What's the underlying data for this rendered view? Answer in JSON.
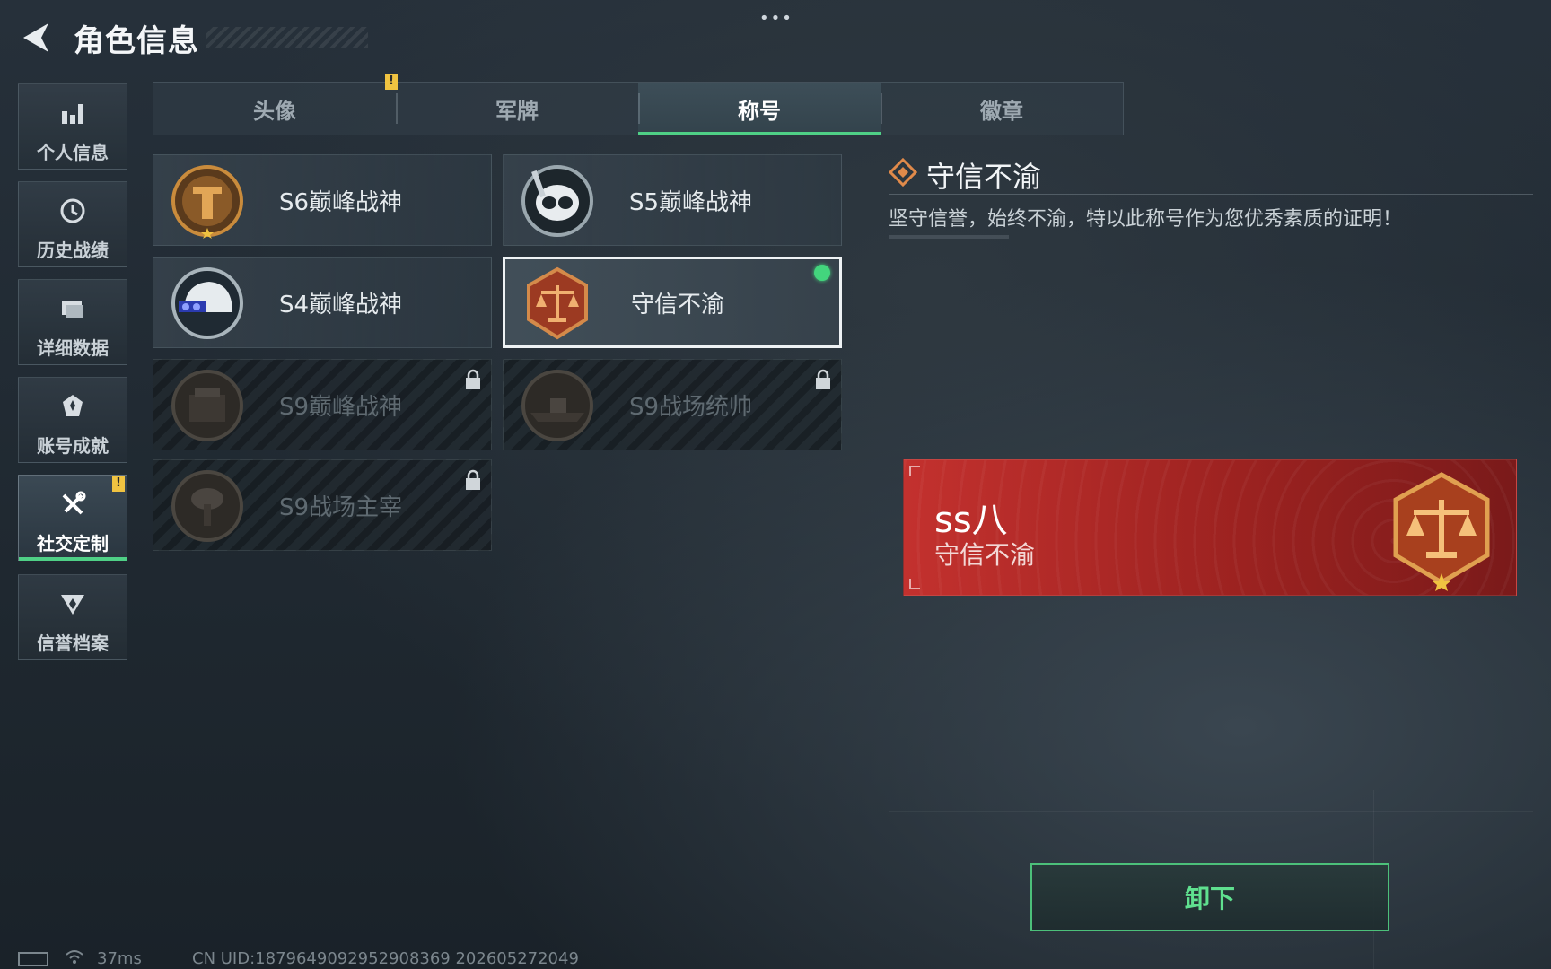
{
  "header": {
    "title": "角色信息",
    "more": "•••"
  },
  "sidebar": {
    "items": [
      {
        "label": "个人信息",
        "icon": "bar-chart-icon"
      },
      {
        "label": "历史战绩",
        "icon": "clock-icon"
      },
      {
        "label": "详细数据",
        "icon": "folder-icon"
      },
      {
        "label": "账号成就",
        "icon": "medal-icon"
      },
      {
        "label": "社交定制",
        "icon": "tools-icon",
        "active": true,
        "badge": "!"
      },
      {
        "label": "信誉档案",
        "icon": "shield-wings-icon"
      }
    ]
  },
  "tabs": {
    "items": [
      {
        "label": "头像"
      },
      {
        "label": "军牌",
        "badge": "!"
      },
      {
        "label": "称号",
        "active": true
      },
      {
        "label": "徽章"
      }
    ]
  },
  "titles": [
    {
      "name": "S6巅峰战神",
      "locked": false
    },
    {
      "name": "S5巅峰战神",
      "locked": false
    },
    {
      "name": "S4巅峰战神",
      "locked": false
    },
    {
      "name": "守信不渝",
      "locked": false,
      "selected": true,
      "equipped": true
    },
    {
      "name": "S9巅峰战神",
      "locked": true
    },
    {
      "name": "S9战场统帅",
      "locked": true
    },
    {
      "name": "S9战场主宰",
      "locked": true
    }
  ],
  "detail": {
    "name": "守信不渝",
    "description": "坚守信誉，始终不渝，特以此称号作为您优秀素质的证明！",
    "preview": {
      "nickname": "ss八",
      "title": "守信不渝"
    },
    "unequip_label": "卸下"
  },
  "footer": {
    "ping": "37ms",
    "uid": "CN UID:1879649092952908369 202605272049"
  },
  "colors": {
    "accent_green": "#4fd086",
    "banner_red": "#c3312e",
    "warning_yellow": "#f0c341"
  }
}
